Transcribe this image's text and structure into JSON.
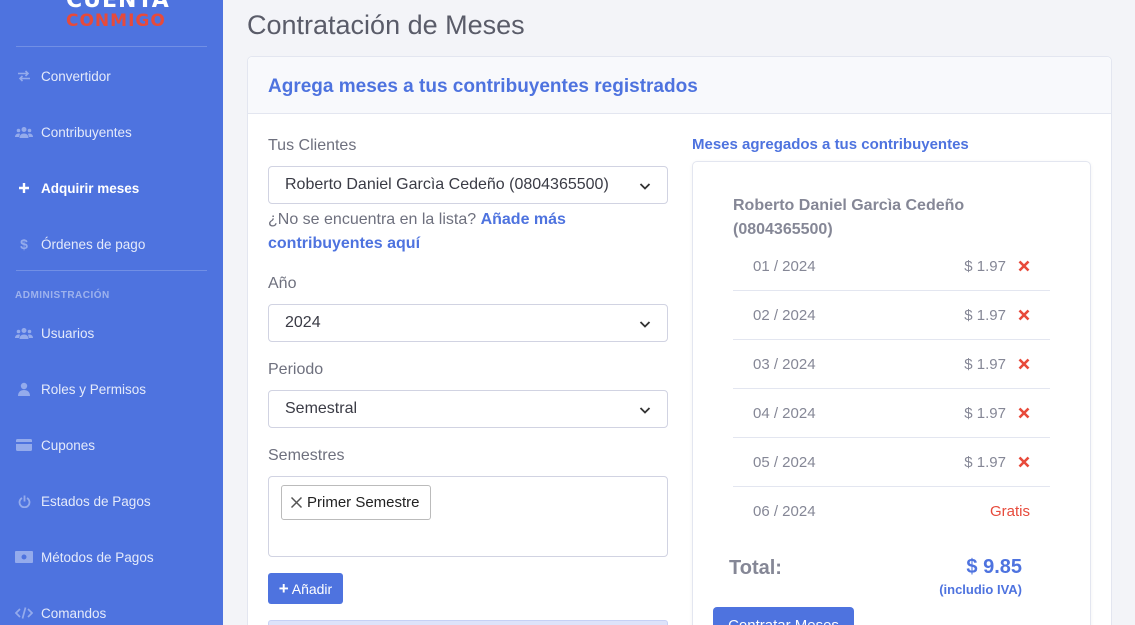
{
  "brand": {
    "line1": "CUENTA",
    "line2": "CONMIGO"
  },
  "sidebar": {
    "items": [
      {
        "label": "Convertidor",
        "icon": "exchange-icon"
      },
      {
        "label": "Contribuyentes",
        "icon": "users-icon"
      },
      {
        "label": "Adquirir meses",
        "icon": "plus-icon"
      },
      {
        "label": "Órdenes de pago",
        "icon": "dollar-icon"
      }
    ],
    "heading": "ADMINISTRACIÓN",
    "admin_items": [
      {
        "label": "Usuarios",
        "icon": "users-icon"
      },
      {
        "label": "Roles y Permisos",
        "icon": "user-icon"
      },
      {
        "label": "Cupones",
        "icon": "card-icon"
      },
      {
        "label": "Estados de Pagos",
        "icon": "power-icon"
      },
      {
        "label": "Métodos de Pagos",
        "icon": "money-icon"
      },
      {
        "label": "Comandos",
        "icon": "code-icon"
      }
    ]
  },
  "page": {
    "title": "Contratación de Meses"
  },
  "card": {
    "header": "Agrega meses a tus contribuyentes registrados"
  },
  "form": {
    "clients_label": "Tus Clientes",
    "client_value": "Roberto Daniel Garcìa Cedeño (0804365500)",
    "help_text": "¿No se encuentra en la lista?",
    "help_link": "Añade más contribuyentes aquí",
    "year_label": "Año",
    "year_value": "2024",
    "period_label": "Periodo",
    "period_value": "Semestral",
    "semesters_label": "Semestres",
    "chip": "Primer Semestre",
    "add_button": "Añadir"
  },
  "summary": {
    "title": "Meses agregados a tus contribuyentes",
    "client_name": "Roberto Daniel Garcìa Cedeño (0804365500)",
    "rows": [
      {
        "month": "01 / 2024",
        "price": "$ 1.97"
      },
      {
        "month": "02 / 2024",
        "price": "$ 1.97"
      },
      {
        "month": "03 / 2024",
        "price": "$ 1.97"
      },
      {
        "month": "04 / 2024",
        "price": "$ 1.97"
      },
      {
        "month": "05 / 2024",
        "price": "$ 1.97"
      },
      {
        "month": "06 / 2024",
        "price": "Gratis"
      }
    ],
    "total_label": "Total:",
    "total_value": "$ 9.85",
    "iva_note": "(includio IVA)",
    "contract_button": "Contratar Meses"
  }
}
